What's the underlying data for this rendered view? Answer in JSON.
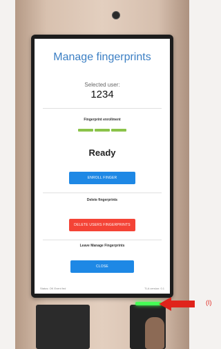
{
  "screen": {
    "title": "Manage fingerprints",
    "selected_user_label": "Selected user:",
    "selected_user_value": "1234",
    "enrollment_label": "Fingerprint enrollment",
    "enrollment_progress": 1.0,
    "status_text": "Ready",
    "enroll_button_label": "ENROLL FINGER",
    "delete_section_label": "Delete fingerprints",
    "delete_button_label": "DELETE USERS FINGERPRINTS",
    "leave_section_label": "Leave Manage Fingerprints",
    "close_button_label": "CLOSE",
    "footer_left": "Status: OK Event fed",
    "footer_right": "TLA version: 0.1"
  },
  "annotation": {
    "label": "(I)",
    "color": "#e0231b"
  },
  "colors": {
    "accent": "#1e88e5",
    "danger": "#f44336",
    "progress": "#8bc34a",
    "title": "#3b7fc4",
    "sensor_light": "#44ff55"
  }
}
